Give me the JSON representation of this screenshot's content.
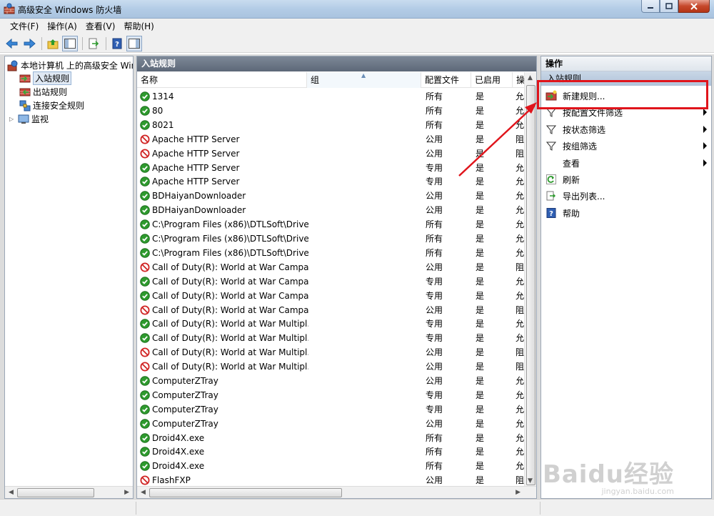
{
  "window": {
    "title": "高级安全 Windows 防火墙"
  },
  "menu": [
    "文件(F)",
    "操作(A)",
    "查看(V)",
    "帮助(H)"
  ],
  "toolbar": {
    "icons": [
      "back-icon",
      "forward-icon",
      "up-folder-icon",
      "show-hide-tree-icon",
      "export-icon",
      "help-icon",
      "action-pane-icon"
    ]
  },
  "tree": {
    "root": "本地计算机 上的高级安全 Windows 防火墙",
    "items": [
      {
        "label": "入站规则",
        "icon": "inbound-rules-icon",
        "selected": true
      },
      {
        "label": "出站规则",
        "icon": "outbound-rules-icon",
        "selected": false
      },
      {
        "label": "连接安全规则",
        "icon": "connection-security-icon",
        "selected": false
      },
      {
        "label": "监视",
        "icon": "monitor-icon",
        "selected": false
      }
    ]
  },
  "center": {
    "title": "入站规则",
    "columns": [
      "名称",
      "组",
      "配置文件",
      "已启用",
      "操作"
    ],
    "rows": [
      {
        "name": "1314",
        "profile": "所有",
        "enabled": "是",
        "action": "允许",
        "allow": true
      },
      {
        "name": "80",
        "profile": "所有",
        "enabled": "是",
        "action": "允许",
        "allow": true
      },
      {
        "name": "8021",
        "profile": "所有",
        "enabled": "是",
        "action": "允许",
        "allow": true
      },
      {
        "name": "Apache HTTP Server",
        "profile": "公用",
        "enabled": "是",
        "action": "阻止",
        "allow": false
      },
      {
        "name": "Apache HTTP Server",
        "profile": "公用",
        "enabled": "是",
        "action": "阻止",
        "allow": false
      },
      {
        "name": "Apache HTTP Server",
        "profile": "专用",
        "enabled": "是",
        "action": "允许",
        "allow": true
      },
      {
        "name": "Apache HTTP Server",
        "profile": "专用",
        "enabled": "是",
        "action": "允许",
        "allow": true
      },
      {
        "name": "BDHaiyanDownloader",
        "profile": "公用",
        "enabled": "是",
        "action": "允许",
        "allow": true
      },
      {
        "name": "BDHaiyanDownloader",
        "profile": "公用",
        "enabled": "是",
        "action": "允许",
        "allow": true
      },
      {
        "name": "C:\\Program Files (x86)\\DTLSoft\\Drive...",
        "profile": "所有",
        "enabled": "是",
        "action": "允许",
        "allow": true
      },
      {
        "name": "C:\\Program Files (x86)\\DTLSoft\\Drive...",
        "profile": "所有",
        "enabled": "是",
        "action": "允许",
        "allow": true
      },
      {
        "name": "C:\\Program Files (x86)\\DTLSoft\\Drive...",
        "profile": "所有",
        "enabled": "是",
        "action": "允许",
        "allow": true
      },
      {
        "name": "Call of Duty(R): World at War Campai...",
        "profile": "公用",
        "enabled": "是",
        "action": "阻止",
        "allow": false
      },
      {
        "name": "Call of Duty(R): World at War Campai...",
        "profile": "专用",
        "enabled": "是",
        "action": "允许",
        "allow": true
      },
      {
        "name": "Call of Duty(R): World at War Campai...",
        "profile": "专用",
        "enabled": "是",
        "action": "允许",
        "allow": true
      },
      {
        "name": "Call of Duty(R): World at War Campai...",
        "profile": "公用",
        "enabled": "是",
        "action": "阻止",
        "allow": false
      },
      {
        "name": "Call of Duty(R): World at War Multipl...",
        "profile": "专用",
        "enabled": "是",
        "action": "允许",
        "allow": true
      },
      {
        "name": "Call of Duty(R): World at War Multipl...",
        "profile": "专用",
        "enabled": "是",
        "action": "允许",
        "allow": true
      },
      {
        "name": "Call of Duty(R): World at War Multipl...",
        "profile": "公用",
        "enabled": "是",
        "action": "阻止",
        "allow": false
      },
      {
        "name": "Call of Duty(R): World at War Multipl...",
        "profile": "公用",
        "enabled": "是",
        "action": "阻止",
        "allow": false
      },
      {
        "name": "ComputerZTray",
        "profile": "公用",
        "enabled": "是",
        "action": "允许",
        "allow": true
      },
      {
        "name": "ComputerZTray",
        "profile": "专用",
        "enabled": "是",
        "action": "允许",
        "allow": true
      },
      {
        "name": "ComputerZTray",
        "profile": "专用",
        "enabled": "是",
        "action": "允许",
        "allow": true
      },
      {
        "name": "ComputerZTray",
        "profile": "公用",
        "enabled": "是",
        "action": "允许",
        "allow": true
      },
      {
        "name": "Droid4X.exe",
        "profile": "所有",
        "enabled": "是",
        "action": "允许",
        "allow": true
      },
      {
        "name": "Droid4X.exe",
        "profile": "所有",
        "enabled": "是",
        "action": "允许",
        "allow": true
      },
      {
        "name": "Droid4X.exe",
        "profile": "所有",
        "enabled": "是",
        "action": "允许",
        "allow": true
      },
      {
        "name": "FlashFXP",
        "profile": "公用",
        "enabled": "是",
        "action": "阻止",
        "allow": false
      }
    ]
  },
  "actions": {
    "title": "操作",
    "section": "入站规则",
    "items": [
      {
        "label": "新建规则...",
        "icon": "new-rule-icon",
        "submenu": false
      },
      {
        "label": "按配置文件筛选",
        "icon": "filter-icon",
        "submenu": true
      },
      {
        "label": "按状态筛选",
        "icon": "filter-icon",
        "submenu": true
      },
      {
        "label": "按组筛选",
        "icon": "filter-icon",
        "submenu": true
      },
      {
        "label": "查看",
        "icon": "",
        "submenu": true
      },
      {
        "label": "刷新",
        "icon": "refresh-icon",
        "submenu": false
      },
      {
        "label": "导出列表...",
        "icon": "export-list-icon",
        "submenu": false
      },
      {
        "label": "帮助",
        "icon": "help-icon",
        "submenu": false
      }
    ]
  },
  "colors": {
    "highlight": "#e0141b",
    "allow": "#2e9a2e",
    "block": "#d02323",
    "header": "#6a7585"
  },
  "watermark": {
    "text": "Baidu经验",
    "sub": "jingyan.baidu.com"
  }
}
